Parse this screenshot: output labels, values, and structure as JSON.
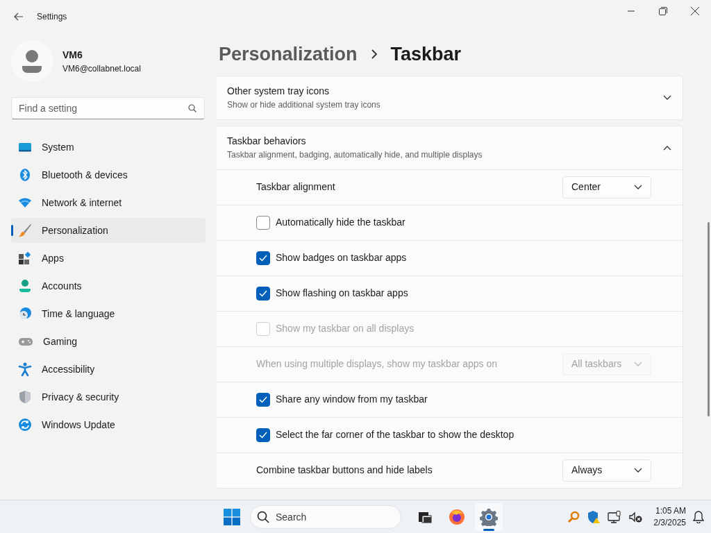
{
  "window": {
    "title": "Settings"
  },
  "user": {
    "name": "VM6",
    "email": "VM6@collabnet.local"
  },
  "search": {
    "placeholder": "Find a setting"
  },
  "sidebar": {
    "items": [
      {
        "label": "System",
        "selected": false
      },
      {
        "label": "Bluetooth & devices",
        "selected": false
      },
      {
        "label": "Network & internet",
        "selected": false
      },
      {
        "label": "Personalization",
        "selected": true
      },
      {
        "label": "Apps",
        "selected": false
      },
      {
        "label": "Accounts",
        "selected": false
      },
      {
        "label": "Time & language",
        "selected": false
      },
      {
        "label": "Gaming",
        "selected": false
      },
      {
        "label": "Accessibility",
        "selected": false
      },
      {
        "label": "Privacy & security",
        "selected": false
      },
      {
        "label": "Windows Update",
        "selected": false
      }
    ]
  },
  "breadcrumb": [
    "Personalization",
    "Taskbar"
  ],
  "sections": [
    {
      "title": "Other system tray icons",
      "subtitle": "Show or hide additional system tray icons",
      "expanded": false
    },
    {
      "title": "Taskbar behaviors",
      "subtitle": "Taskbar alignment, badging, automatically hide, and multiple displays",
      "expanded": true,
      "rows": [
        {
          "kind": "dropdown",
          "label": "Taskbar alignment",
          "value": "Center",
          "disabled": false
        },
        {
          "kind": "checkbox",
          "label": "Automatically hide the taskbar",
          "checked": false,
          "disabled": false
        },
        {
          "kind": "checkbox",
          "label": "Show badges on taskbar apps",
          "checked": true,
          "disabled": false
        },
        {
          "kind": "checkbox",
          "label": "Show flashing on taskbar apps",
          "checked": true,
          "disabled": false
        },
        {
          "kind": "checkbox",
          "label": "Show my taskbar on all displays",
          "checked": false,
          "disabled": true
        },
        {
          "kind": "dropdown",
          "label": "When using multiple displays, show my taskbar apps on",
          "value": "All taskbars",
          "disabled": true
        },
        {
          "kind": "checkbox",
          "label": "Share any window from my taskbar",
          "checked": true,
          "disabled": false
        },
        {
          "kind": "checkbox",
          "label": "Select the far corner of the taskbar to show the desktop",
          "checked": true,
          "disabled": false
        },
        {
          "kind": "dropdown",
          "label": "Combine taskbar buttons and hide labels",
          "value": "Always",
          "disabled": false
        }
      ]
    }
  ],
  "taskbar": {
    "search_placeholder": "Search",
    "apps": [
      {
        "active": false
      },
      {
        "active": false
      },
      {
        "active": true
      }
    ],
    "time": "1:05 AM",
    "date": "2/3/2025"
  }
}
